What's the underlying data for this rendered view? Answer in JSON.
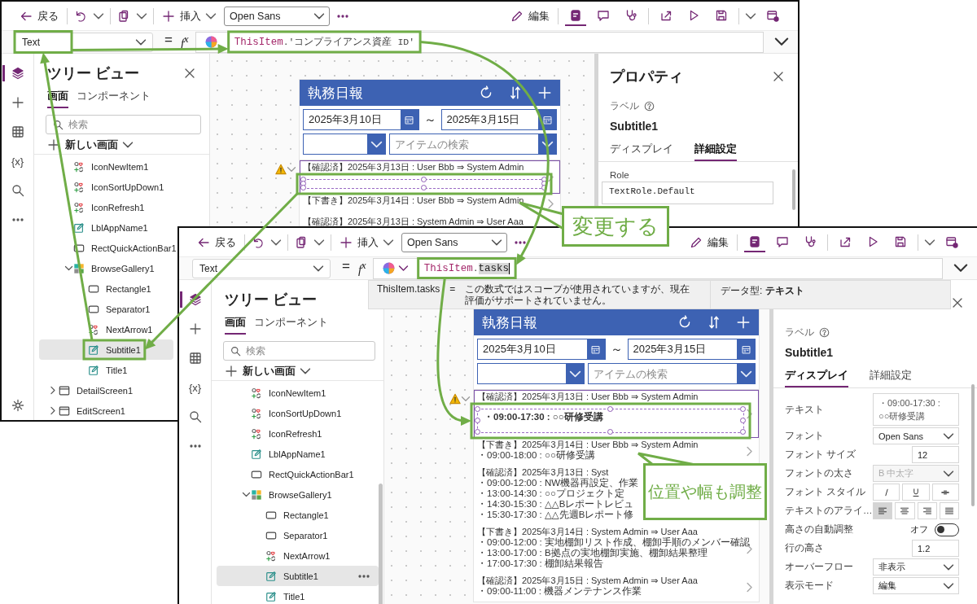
{
  "back_window": {
    "toolbar": {
      "back": "戻る",
      "insert": "挿入",
      "font": "Open Sans",
      "edit": "編集",
      "tools": [
        {
          "kind": "page",
          "selected": true
        },
        {
          "kind": "comment",
          "selected": false
        },
        {
          "kind": "health",
          "selected": false
        },
        {
          "kind": "share",
          "selected": false
        },
        {
          "kind": "play",
          "selected": false
        },
        {
          "kind": "save",
          "selected": false
        },
        {
          "kind": "publish",
          "selected": false
        }
      ]
    },
    "formula_bar": {
      "property": "Text",
      "equals": "=",
      "fx": "f$^{x}$",
      "formula": [
        {
          "kind": "keyword",
          "text": "ThisItem"
        },
        {
          "kind": "plain",
          "text": ".'コンプライアンス資産 ID'"
        }
      ]
    },
    "rail": [
      {
        "kind": "tree",
        "selected": true
      },
      {
        "kind": "insert",
        "selected": false
      },
      {
        "kind": "data",
        "selected": false
      },
      {
        "kind": "variables",
        "label": "{x}",
        "selected": false
      },
      {
        "kind": "search",
        "selected": false
      },
      {
        "kind": "more",
        "selected": false
      },
      {
        "kind": "settings",
        "selected": false
      }
    ],
    "tree": {
      "title": "ツリー ビュー",
      "closable": true,
      "tabs": [
        {
          "label": "画面",
          "selected": true
        },
        {
          "label": "コンポーネント",
          "selected": false
        }
      ],
      "search_placeholder": "検索",
      "new_screen": "新しい画面",
      "screen_children": [
        {
          "name": "IconNewItem1",
          "kind": "icon",
          "selected": false
        },
        {
          "name": "IconSortUpDown1",
          "kind": "icon",
          "selected": false
        },
        {
          "name": "IconRefresh1",
          "kind": "icon",
          "selected": false
        },
        {
          "name": "LblAppName1",
          "kind": "label",
          "selected": false
        },
        {
          "name": "RectQuickActionBar1",
          "kind": "rectangle",
          "selected": false
        },
        {
          "name": "BrowseGallery1",
          "kind": "gallery",
          "selected": false,
          "expanded": true,
          "children": [
            {
              "name": "Rectangle1",
              "kind": "rectangle",
              "selected": false
            },
            {
              "name": "Separator1",
              "kind": "rectangle",
              "selected": false
            },
            {
              "name": "NextArrow1",
              "kind": "icon",
              "selected": false
            },
            {
              "name": "Subtitle1",
              "kind": "label",
              "selected": true
            },
            {
              "name": "Title1",
              "kind": "label",
              "selected": false
            }
          ]
        }
      ],
      "screens": [
        {
          "name": "DetailScreen1",
          "kind": "screen",
          "selected": false,
          "expanded": false
        },
        {
          "name": "EditScreen1",
          "kind": "screen",
          "selected": false,
          "expanded": false
        }
      ]
    },
    "app": {
      "title": "執務日報",
      "date_from": "2025年3月10日",
      "tilde": "～",
      "date_to": "2025年3月15日",
      "search_placeholder": "アイテムの検索",
      "rows": [
        {
          "title": "【確認済】2025年3月13日 : User Bbb ⇒ System Admin",
          "selected": true,
          "subtitle_selected": true,
          "arrow": true
        },
        {
          "title": "【下書き】2025年3月14日 : User Bbb ⇒ System Admin",
          "selected": false,
          "subtitle_selected": false,
          "arrow": true
        },
        {
          "title": "【確認済】2025年3月13日 : System Admin ⇒ User Aaa",
          "selected": false,
          "subtitle_selected": false,
          "arrow": false
        }
      ]
    },
    "properties": {
      "title": "プロパティ",
      "closable": true,
      "type": "ラベル",
      "control": "Subtitle1",
      "tabs": [
        {
          "label": "ディスプレイ",
          "selected": false
        },
        {
          "label": "詳細設定",
          "selected": true
        }
      ],
      "fields": [
        {
          "kind": "code",
          "label": "Role",
          "value": "TextRole.Default"
        }
      ]
    }
  },
  "front_window": {
    "toolbar": {
      "back": "戻る",
      "insert": "挿入",
      "font": "Open Sans",
      "edit": "編集",
      "tools": [
        {
          "kind": "page",
          "selected": true
        },
        {
          "kind": "comment",
          "selected": false
        },
        {
          "kind": "health",
          "selected": false
        },
        {
          "kind": "share",
          "selected": false
        },
        {
          "kind": "play",
          "selected": false
        },
        {
          "kind": "save",
          "selected": false
        },
        {
          "kind": "publish",
          "selected": false
        }
      ]
    },
    "formula_bar": {
      "property": "Text",
      "equals": "=",
      "fx": "f$^{x}$",
      "copilot_menu": true,
      "formula": [
        {
          "kind": "keyword",
          "text": "ThisItem"
        },
        {
          "kind": "plain",
          "text": "."
        },
        {
          "kind": "selection",
          "text": "tasks"
        }
      ]
    },
    "tooltip": {
      "expression": "ThisItem.tasks",
      "equals": "=",
      "message": "この数式ではスコープが使用されていますが、現在評価がサポートされていません。",
      "data_type": "データ型: **テキスト**"
    },
    "rail": [
      {
        "kind": "tree",
        "selected": true
      },
      {
        "kind": "insert",
        "selected": false
      },
      {
        "kind": "data",
        "selected": false
      },
      {
        "kind": "variables",
        "label": "{x}",
        "selected": false
      },
      {
        "kind": "search",
        "selected": false
      },
      {
        "kind": "more",
        "selected": false
      }
    ],
    "tree": {
      "title": "ツリー ビュー",
      "tabs": [
        {
          "label": "画面",
          "selected": true
        },
        {
          "label": "コンポーネント",
          "selected": false
        }
      ],
      "search_placeholder": "検索",
      "new_screen": "新しい画面",
      "screen_children": [
        {
          "name": "IconNewItem1",
          "kind": "icon",
          "selected": false
        },
        {
          "name": "IconSortUpDown1",
          "kind": "icon",
          "selected": false
        },
        {
          "name": "IconRefresh1",
          "kind": "icon",
          "selected": false
        },
        {
          "name": "LblAppName1",
          "kind": "label",
          "selected": false
        },
        {
          "name": "RectQuickActionBar1",
          "kind": "rectangle",
          "selected": false
        },
        {
          "name": "BrowseGallery1",
          "kind": "gallery",
          "selected": false,
          "expanded": true,
          "children": [
            {
              "name": "Rectangle1",
              "kind": "rectangle",
              "selected": false
            },
            {
              "name": "Separator1",
              "kind": "rectangle",
              "selected": false
            },
            {
              "name": "NextArrow1",
              "kind": "icon",
              "selected": false
            },
            {
              "name": "Subtitle1",
              "kind": "label",
              "selected": true,
              "more_button": true
            },
            {
              "name": "Title1",
              "kind": "label",
              "selected": false
            }
          ]
        }
      ]
    },
    "app": {
      "title": "執務日報",
      "date_from": "2025年3月10日",
      "tilde": "～",
      "date_to": "2025年3月15日",
      "search_placeholder": "アイテムの検索",
      "rows": [
        {
          "title": "【確認済】2025年3月13日 : User Bbb ⇒ System Admin",
          "lines": [
            "・09:00-17:30 : ○○研修受講"
          ],
          "selected": true,
          "subtitle_selected": true,
          "arrow": true
        },
        {
          "title": "【下書き】2025年3月14日 : User Bbb ⇒ System Admin",
          "lines": [
            "・09:00-18:00 : ○○研修受講"
          ],
          "selected": false,
          "subtitle_selected": false,
          "arrow": true
        },
        {
          "title": "【確認済】2025年3月13日 : Syst",
          "lines": [
            "・09:00-12:00 : NW機器再設定、作業",
            "・13:00-14:30 : ○○プロジェクト定",
            "・14:30-15:30 : △△Bレポートレビュ",
            "・15:30-17:30 : △△先週Bレポート修"
          ],
          "selected": false,
          "subtitle_selected": false,
          "arrow": false
        },
        {
          "title": "【下書き】2025年3月14日 : System Admin ⇒ User Aaa",
          "lines": [
            "・09:00-12:00 : 実地棚卸リスト作成、棚卸手順のメンバー確認",
            "・13:00-17:00 : B拠点の実地棚卸実施、棚卸結果整理",
            "・17:00-17:30 : 棚卸結果報告"
          ],
          "selected": false,
          "subtitle_selected": false,
          "arrow": true
        },
        {
          "title": "【確認済】2025年3月15日 : System Admin ⇒ User Aaa",
          "lines": [
            "・09:00-11:00 : 機器メンテナンス作業"
          ],
          "selected": false,
          "subtitle_selected": false,
          "arrow": true
        }
      ]
    },
    "properties": {
      "closable": true,
      "type": "ラベル",
      "control": "Subtitle1",
      "tabs": [
        {
          "label": "ディスプレイ",
          "selected": true
        },
        {
          "label": "詳細設定",
          "selected": false
        }
      ],
      "fields": [
        {
          "kind": "textarea",
          "label": "テキスト",
          "value": "・09:00-17:30 : ○○研修受講"
        },
        {
          "kind": "dropdown",
          "label": "フォント",
          "value": "Open Sans",
          "disabled": false
        },
        {
          "kind": "number",
          "label": "フォント サイズ",
          "value": "12"
        },
        {
          "kind": "dropdown",
          "label": "フォントの太さ",
          "value": "B 中太字",
          "disabled": true
        },
        {
          "kind": "buttons",
          "label": "フォント スタイル",
          "options": [
            {
              "kind": "italic",
              "selected": false
            },
            {
              "kind": "underline",
              "selected": false
            },
            {
              "kind": "strikethrough",
              "selected": false
            }
          ]
        },
        {
          "kind": "buttons",
          "label": "テキストのアライ…",
          "options": [
            {
              "kind": "left",
              "selected": true
            },
            {
              "kind": "center",
              "selected": false
            },
            {
              "kind": "right",
              "selected": false
            },
            {
              "kind": "justify",
              "selected": false
            }
          ]
        },
        {
          "kind": "toggle",
          "label": "高さの自動調整",
          "value": "オフ",
          "on": false
        },
        {
          "kind": "number",
          "label": "行の高さ",
          "value": "1.2"
        },
        {
          "kind": "dropdown",
          "label": "オーバーフロー",
          "value": "非表示",
          "disabled": false
        },
        {
          "kind": "dropdown",
          "label": "表示モード",
          "value": "編集",
          "disabled": false
        }
      ]
    }
  },
  "callouts": [
    {
      "text": "変更する"
    },
    {
      "text": "位置や幅も調整"
    }
  ]
}
